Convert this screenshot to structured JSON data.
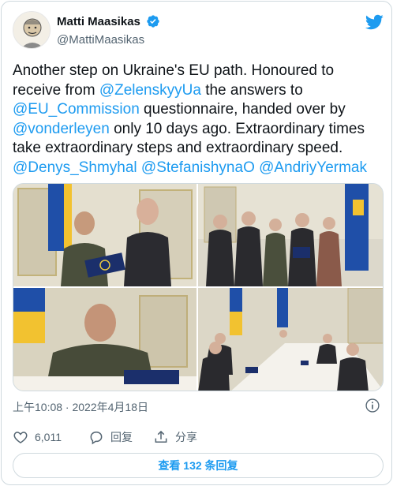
{
  "author": {
    "display_name": "Matti Maasikas",
    "handle": "@MattiMaasikas",
    "verified": true
  },
  "tweet": {
    "t1": "Another step on Ukraine's EU path. Honoured to receive from ",
    "m1": "@ZelenskyyUa",
    "t2": " the answers to ",
    "m2": "@EU_Commission",
    "t3": " questionnaire, handed over by ",
    "m3": "@vonderleyen",
    "t4": " only 10 days ago. Extraordinary times take extraordinary steps and extraordinary speed. ",
    "m4": "@Denys_Shmyhal",
    "m5": "@StefanishynaO",
    "m6": "@AndriyYermak"
  },
  "timestamp": "上午10:08 · 2022年4月18日",
  "actions": {
    "likes_count": "6,011",
    "reply_label": "回复",
    "share_label": "分享"
  },
  "view_replies_label": "查看 132 条回复",
  "colors": {
    "link": "#1d9bf0",
    "text": "#0f1419",
    "muted": "#536471",
    "border": "#cfd9de"
  },
  "icons": [
    "twitter-bird-icon",
    "verified-badge-icon",
    "info-icon",
    "heart-icon",
    "reply-bubble-icon",
    "share-icon"
  ]
}
